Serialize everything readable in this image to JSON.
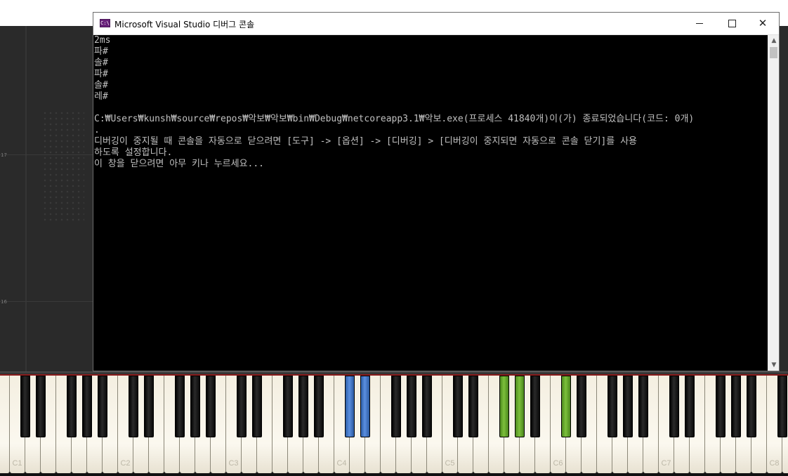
{
  "window": {
    "title": "Microsoft Visual Studio 디버그 콘솔",
    "icon": "console-app-icon",
    "icon_text": "C:\\",
    "minimize_icon": "minimize-icon",
    "maximize_icon": "maximize-icon",
    "close_icon": "close-icon",
    "close_glyph": "✕"
  },
  "console": {
    "lines": [
      "2ms",
      "파#",
      "솔#",
      "파#",
      "솔#",
      "레#",
      "",
      "C:₩Users₩kunsh₩source₩repos₩악보₩악보₩bin₩Debug₩netcoreapp3.1₩악보.exe(프로세스 41840개)이(가) 종료되었습니다(코드: 0개)",
      ".",
      "디버깅이 중지될 때 콘솔을 자동으로 닫으려면 [도구] -> [옵션] -> [디버깅] > [디버깅이 중지되면 자동으로 콘솔 닫기]를 사용",
      "하도록 설정합니다.",
      "이 창을 닫으려면 아무 키나 누르세요..."
    ]
  },
  "scrollbar": {
    "up_glyph": "▲",
    "down_glyph": "▼"
  },
  "background_app": {
    "measure_numbers": [
      "17",
      "16"
    ]
  },
  "keyboard": {
    "octave_labels": [
      "C1",
      "C2",
      "C3",
      "C4",
      "C5",
      "C6",
      "C7",
      "C8"
    ],
    "highlighted_black_keys": {
      "blue": [
        "C#4",
        "D#4"
      ],
      "green": [
        "F#5",
        "G#5",
        "C#6"
      ]
    },
    "colors": {
      "blue": "#4a7fd0",
      "green": "#6cb030",
      "red_line": "#8a1d1d"
    }
  }
}
